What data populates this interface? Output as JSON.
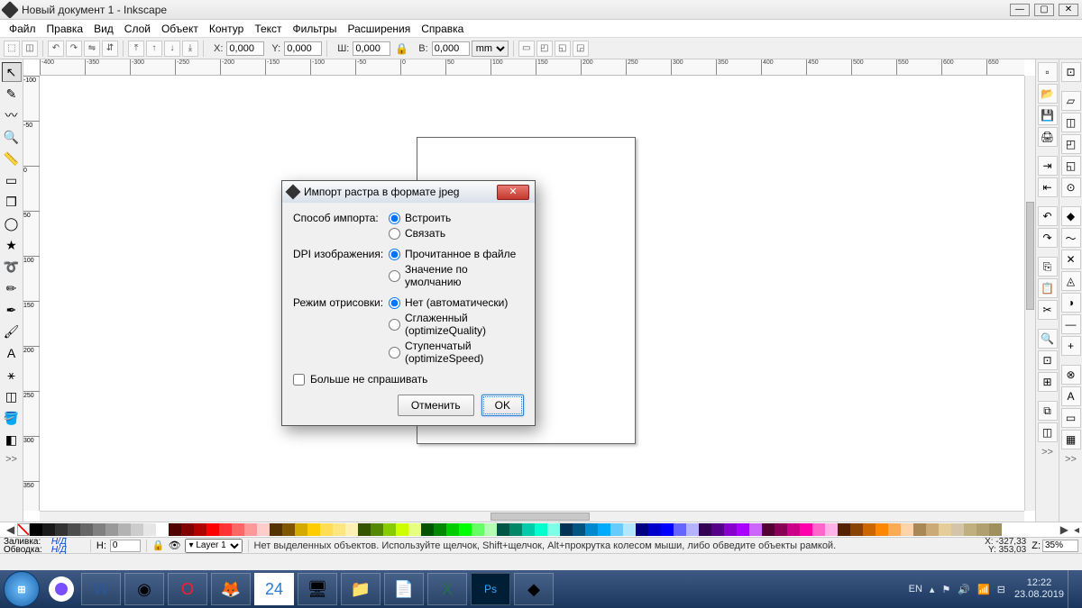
{
  "window": {
    "title": "Новый документ 1 - Inkscape"
  },
  "menu": {
    "file": "Файл",
    "edit": "Правка",
    "view": "Вид",
    "layer": "Слой",
    "object": "Объект",
    "path": "Контур",
    "text": "Текст",
    "filters": "Фильтры",
    "extensions": "Расширения",
    "help": "Справка"
  },
  "toolbar": {
    "x_label": "X:",
    "x": "0,000",
    "y_label": "Y:",
    "y": "0,000",
    "w_label": "Ш:",
    "w": "0,000",
    "h_label": "В:",
    "h": "0,000",
    "unit": "mm"
  },
  "dialog": {
    "title": "Импорт растра в формате jpeg",
    "import_method_label": "Способ импорта:",
    "import_embed": "Встроить",
    "import_link": "Связать",
    "dpi_label": "DPI изображения:",
    "dpi_file": "Прочитанное в файле",
    "dpi_default": "Значение по умолчанию",
    "render_label": "Режим отрисовки:",
    "render_auto": "Нет (автоматически)",
    "render_quality": "Сглаженный (optimizeQuality)",
    "render_speed": "Ступенчатый (optimizeSpeed)",
    "dont_ask": "Больше не спрашивать",
    "cancel": "Отменить",
    "ok": "OK"
  },
  "status": {
    "fill_label": "Заливка:",
    "stroke_label": "Обводка:",
    "na": "Н/Д",
    "o_label": "Н:",
    "o_value": "0",
    "layer": "Layer 1",
    "hint": "Нет выделенных объектов. Используйте щелчок, Shift+щелчок, Alt+прокрутка колесом мыши, либо обведите объекты рамкой.",
    "coord_x_label": "X:",
    "coord_x": "-327,33",
    "coord_y_label": "Y:",
    "coord_y": "353,03",
    "z_label": "Z:",
    "zoom": "35%"
  },
  "tray": {
    "lang": "EN",
    "time": "12:22",
    "date": "23.08.2019",
    "numlock": "24"
  },
  "palette_colors": [
    "#000000",
    "#1a1a1a",
    "#333333",
    "#4d4d4d",
    "#666666",
    "#808080",
    "#999999",
    "#b3b3b3",
    "#cccccc",
    "#e6e6e6",
    "#ffffff",
    "#510000",
    "#800000",
    "#b30000",
    "#ff0000",
    "#ff3333",
    "#ff6666",
    "#ff9999",
    "#ffcccc",
    "#553300",
    "#805500",
    "#d4aa00",
    "#ffcc00",
    "#ffdd55",
    "#ffe680",
    "#fff0b3",
    "#335500",
    "#558800",
    "#88cc00",
    "#ccff00",
    "#e6ff80",
    "#005500",
    "#008800",
    "#00cc00",
    "#00ff00",
    "#66ff66",
    "#b3ffb3",
    "#005544",
    "#008866",
    "#00ccaa",
    "#00ffcc",
    "#80ffe6",
    "#003355",
    "#005580",
    "#0088cc",
    "#00aaff",
    "#66ccff",
    "#b3e6ff",
    "#000080",
    "#0000cc",
    "#0000ff",
    "#6666ff",
    "#b3b3ff",
    "#330055",
    "#550088",
    "#8800cc",
    "#aa00ff",
    "#cc66ff",
    "#550033",
    "#880055",
    "#cc0088",
    "#ff00aa",
    "#ff66cc",
    "#ffb3e6",
    "#552200",
    "#884400",
    "#cc6600",
    "#ff8800",
    "#ffaa55",
    "#ffd4aa",
    "#aa8855",
    "#ccaa77",
    "#e6cc99",
    "#d4c4a8",
    "#c0b080",
    "#b0a070",
    "#a09060"
  ]
}
